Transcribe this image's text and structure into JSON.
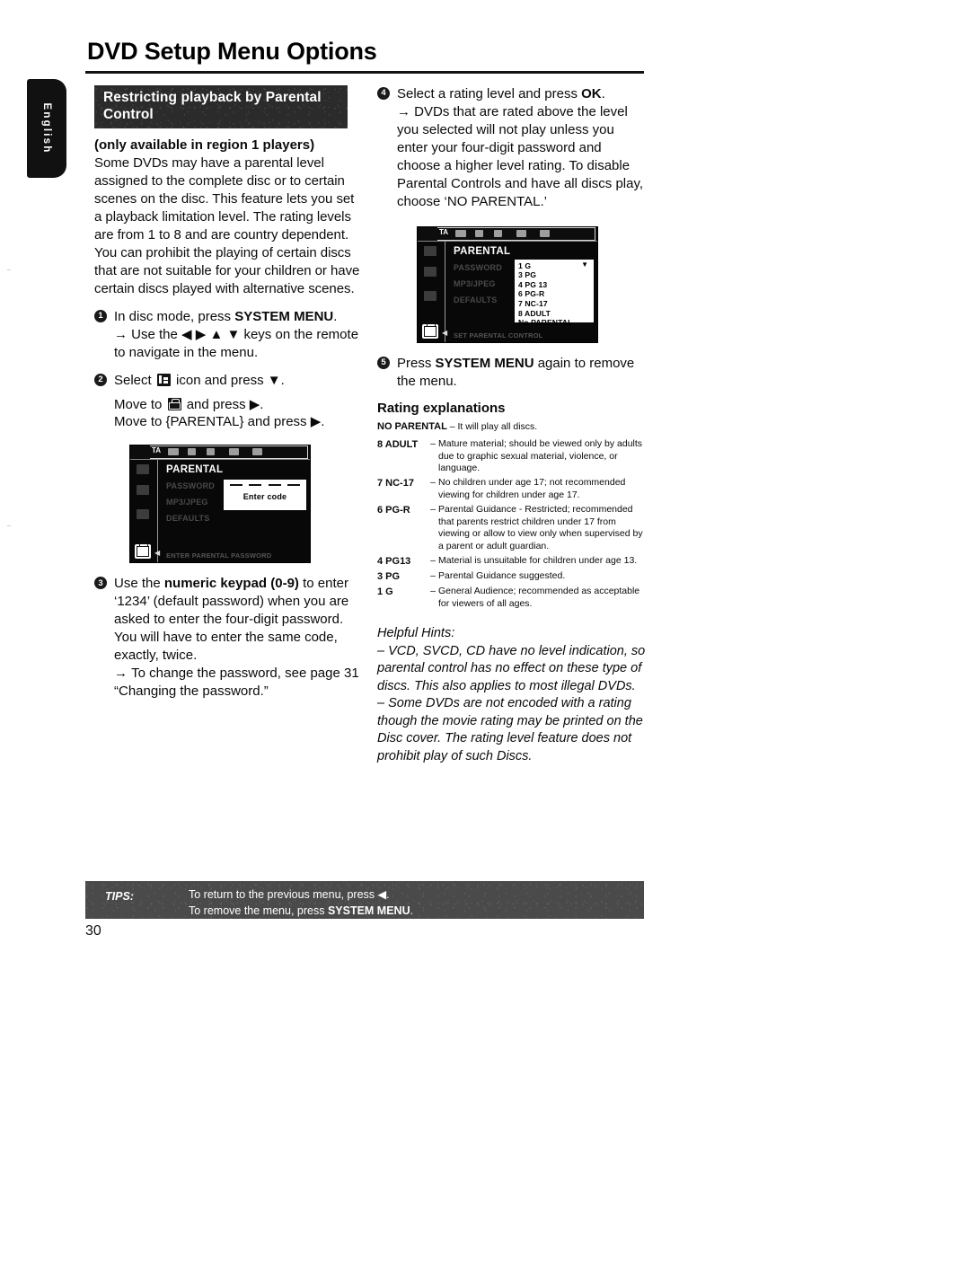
{
  "document": {
    "page_title": "DVD Setup Menu Options",
    "page_number": "30",
    "language_tab": "English"
  },
  "left_column": {
    "section_banner": "Restricting playback by Parental Control",
    "intro_bold": "(only available in region 1 players)",
    "intro_body": "Some DVDs may have a parental level assigned to the complete disc or to certain scenes on the disc. This feature lets you set a playback limitation level. The rating levels are from 1 to 8 and are country dependent. You can prohibit the playing of certain discs that are not suitable for your children or have certain discs played with alternative scenes.",
    "steps": [
      {
        "number": "1",
        "text_before": "In disc mode, press ",
        "bold": "SYSTEM MENU",
        "text_after": ".",
        "arrow_line": "Use the ◀ ▶ ▲ ▼ keys on the remote to navigate in the menu."
      },
      {
        "number": "2",
        "line1_before": "Select ",
        "line1_icon": "setup-tools-icon",
        "line1_after": " icon and press ▼.",
        "line2_before": "Move to ",
        "line2_icon": "preferences-case-icon",
        "line2_after": " and press ▶.",
        "line3": "Move to {PARENTAL} and press ▶."
      },
      {
        "number": "3",
        "text_before": "Use the ",
        "bold": "numeric keypad (0-9)",
        "text_after": " to enter ‘1234’ (default password) when you are asked to enter the four-digit password. You will have to enter the same code, exactly, twice.",
        "arrow_line": "To change the password, see page 31 “Changing the password.”"
      }
    ],
    "screenshot": {
      "toolbar_label": "TA",
      "menu_title": "PARENTAL",
      "menu_items": [
        "PASSWORD",
        "MP3/JPEG",
        "DEFAULTS"
      ],
      "status_line": "ENTER PARENTAL PASSWORD",
      "code_popup_label": "Enter code",
      "code_popup_dashes": 4
    }
  },
  "right_column": {
    "steps": [
      {
        "number": "4",
        "text_before": "Select a rating level and press ",
        "bold": "OK",
        "text_after": ".",
        "arrow_line": "DVDs that are rated above the level you selected will not play unless you enter your four-digit password and choose a higher level rating. To disable Parental Controls and have all discs play, choose ‘NO PARENTAL.’"
      },
      {
        "number": "5",
        "text_before": "Press ",
        "bold": "SYSTEM MENU",
        "text_after": " again to remove the menu."
      }
    ],
    "screenshot": {
      "toolbar_label": "TA",
      "menu_title": "PARENTAL",
      "menu_items": [
        "PASSWORD",
        "MP3/JPEG",
        "DEFAULTS"
      ],
      "status_line": "SET PARENTAL CONTROL",
      "rating_options": [
        "1 G",
        "3 PG",
        "4 PG 13",
        "6 PG-R",
        "7 NC-17",
        "8 ADULT",
        "No PARENTAL"
      ],
      "selected_marker": "▼"
    },
    "ratings_heading": "Rating explanations",
    "no_parental": {
      "label": "NO PARENTAL",
      "dash": "–",
      "text": "It will play all discs."
    },
    "ratings": [
      {
        "label": "8 ADULT",
        "dash": "–",
        "text": "Mature material; should be viewed only by adults due to graphic sexual material, violence, or language."
      },
      {
        "label": "7 NC-17",
        "dash": "–",
        "text": "No children under age 17; not recommended viewing for children under age 17."
      },
      {
        "label": "6 PG-R",
        "dash": "–",
        "text": "Parental Guidance - Restricted; recommended that parents restrict children under 17 from viewing or allow to view only when supervised by a parent or adult guardian."
      },
      {
        "label": "4 PG13",
        "dash": "–",
        "text": "Material is unsuitable for children under age 13."
      },
      {
        "label": "3 PG",
        "dash": "–",
        "text": "Parental Guidance suggested."
      },
      {
        "label": "1 G",
        "dash": "–",
        "text": "General Audience; recommended as acceptable for viewers of all ages."
      }
    ],
    "hints": {
      "title": "Helpful Hints:",
      "items": [
        "– VCD, SVCD, CD have no level indication, so parental control has no effect on these type of discs. This also applies to most illegal DVDs.",
        "– Some DVDs are not encoded with a rating though the movie rating may be printed on the Disc cover. The rating level feature does not prohibit play of such Discs."
      ]
    }
  },
  "tips": {
    "label": "TIPS:",
    "line1": "To return to the previous menu, press ◀.",
    "line2_before": "To remove the menu, press ",
    "line2_bold": "SYSTEM MENU",
    "line2_after": "."
  }
}
